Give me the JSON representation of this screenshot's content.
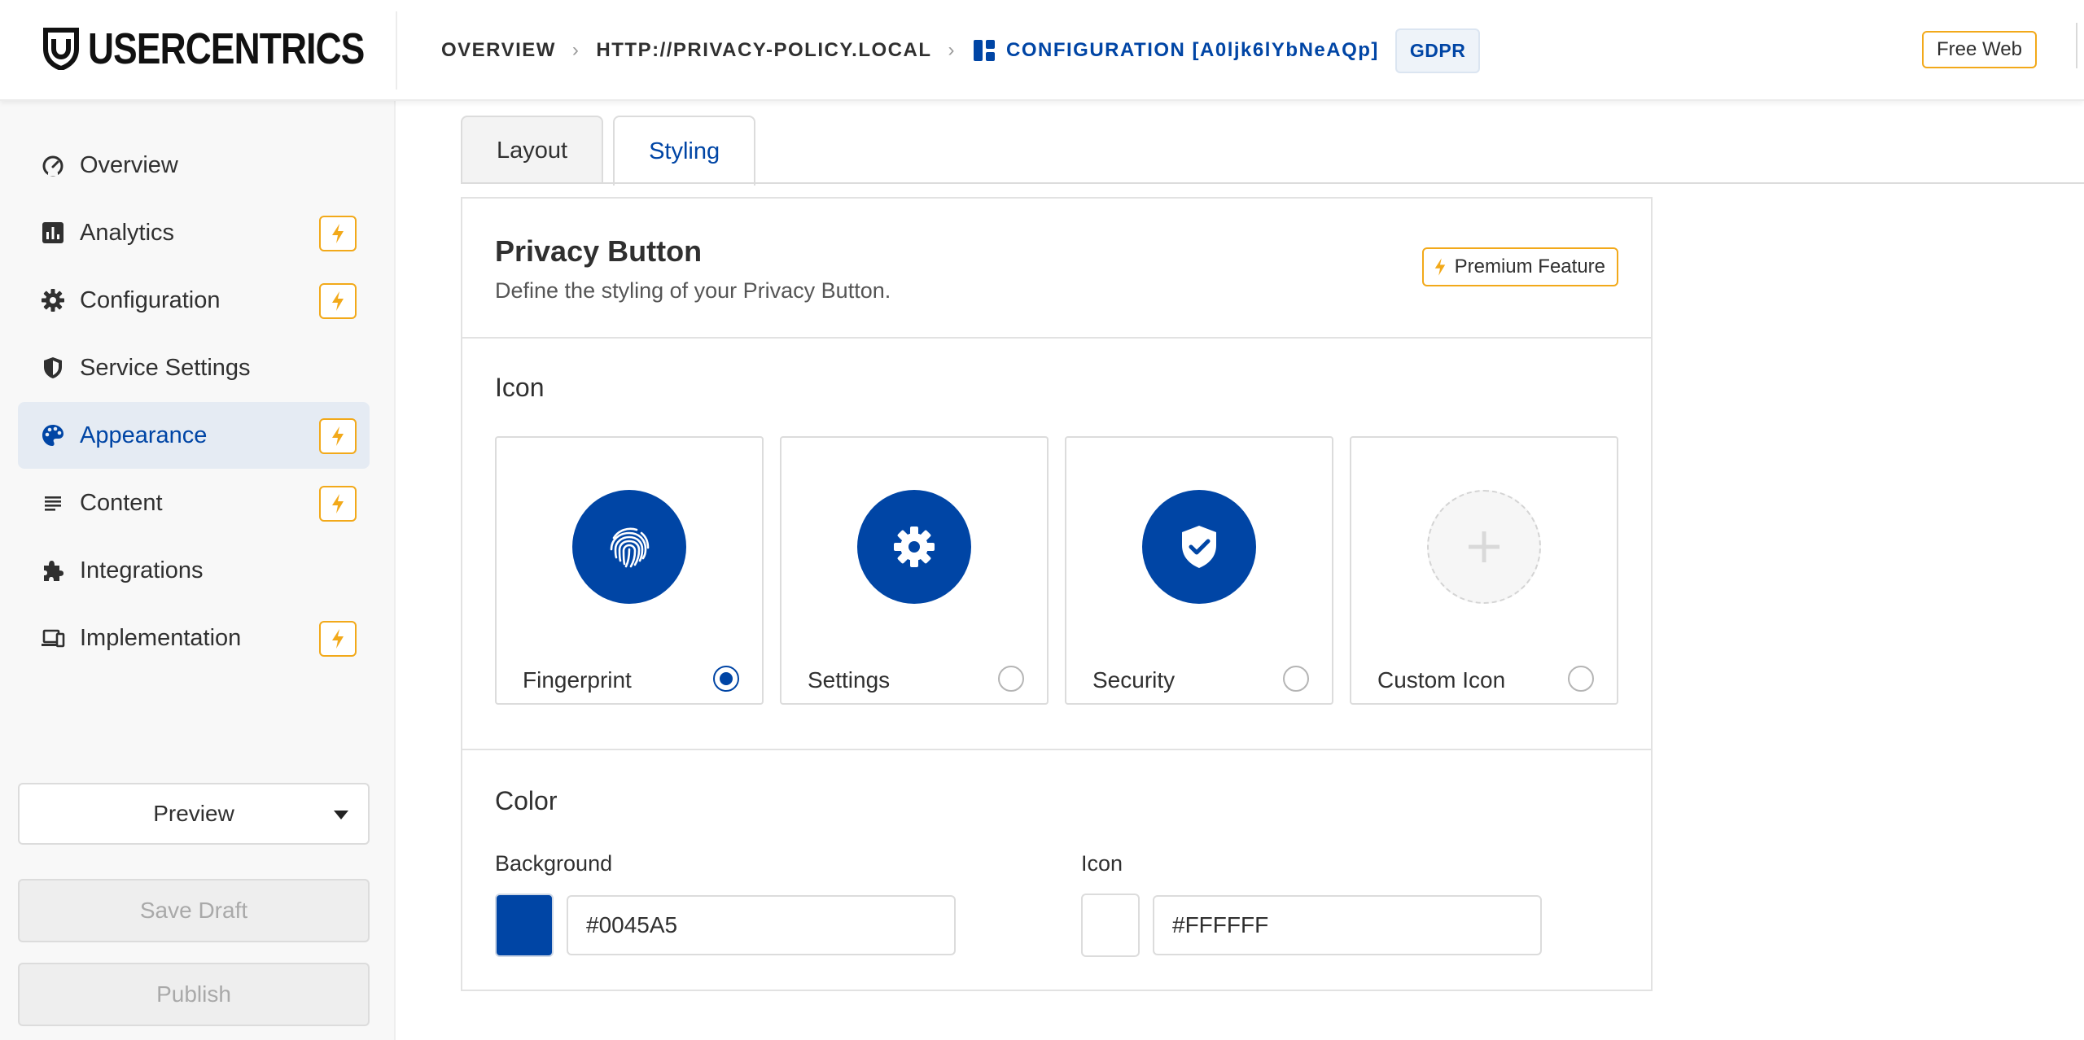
{
  "brand": {
    "name": "USERCENTRICS"
  },
  "breadcrumb": {
    "items": [
      "OVERVIEW",
      "HTTP://PRIVACY-POLICY.LOCAL"
    ],
    "current": "CONFIGURATION [A0ljk6lYbNeAQp]",
    "badge": "GDPR"
  },
  "plan_badge": "Free Web",
  "sidebar": {
    "items": [
      {
        "label": "Overview",
        "icon": "speedometer-icon",
        "premium": false,
        "active": false
      },
      {
        "label": "Analytics",
        "icon": "bar-chart-icon",
        "premium": true,
        "active": false
      },
      {
        "label": "Configuration",
        "icon": "gear-icon",
        "premium": true,
        "active": false
      },
      {
        "label": "Service Settings",
        "icon": "shield-icon",
        "premium": false,
        "active": false
      },
      {
        "label": "Appearance",
        "icon": "palette-icon",
        "premium": true,
        "active": true
      },
      {
        "label": "Content",
        "icon": "text-lines-icon",
        "premium": true,
        "active": false
      },
      {
        "label": "Integrations",
        "icon": "puzzle-icon",
        "premium": false,
        "active": false
      },
      {
        "label": "Implementation",
        "icon": "devices-icon",
        "premium": true,
        "active": false
      }
    ],
    "preview_label": "Preview",
    "save_draft_label": "Save Draft",
    "publish_label": "Publish"
  },
  "tabs": [
    {
      "label": "Layout",
      "active": false
    },
    {
      "label": "Styling",
      "active": true
    }
  ],
  "card": {
    "title": "Privacy Button",
    "subtitle": "Define the styling of your Privacy Button.",
    "premium_label": "Premium Feature",
    "icon_section": {
      "title": "Icon",
      "options": [
        {
          "label": "Fingerprint",
          "icon": "fingerprint-icon",
          "selected": true
        },
        {
          "label": "Settings",
          "icon": "gear-icon",
          "selected": false
        },
        {
          "label": "Security",
          "icon": "shield-check-icon",
          "selected": false
        },
        {
          "label": "Custom Icon",
          "icon": "plus-icon",
          "selected": false
        }
      ]
    },
    "color_section": {
      "title": "Color",
      "background_label": "Background",
      "background_value": "#0045A5",
      "icon_label": "Icon",
      "icon_value": "#FFFFFF"
    }
  },
  "colors": {
    "accent": "#0045a5",
    "premium": "#f2a91a",
    "active_nav_bg": "#e5ebf3"
  }
}
